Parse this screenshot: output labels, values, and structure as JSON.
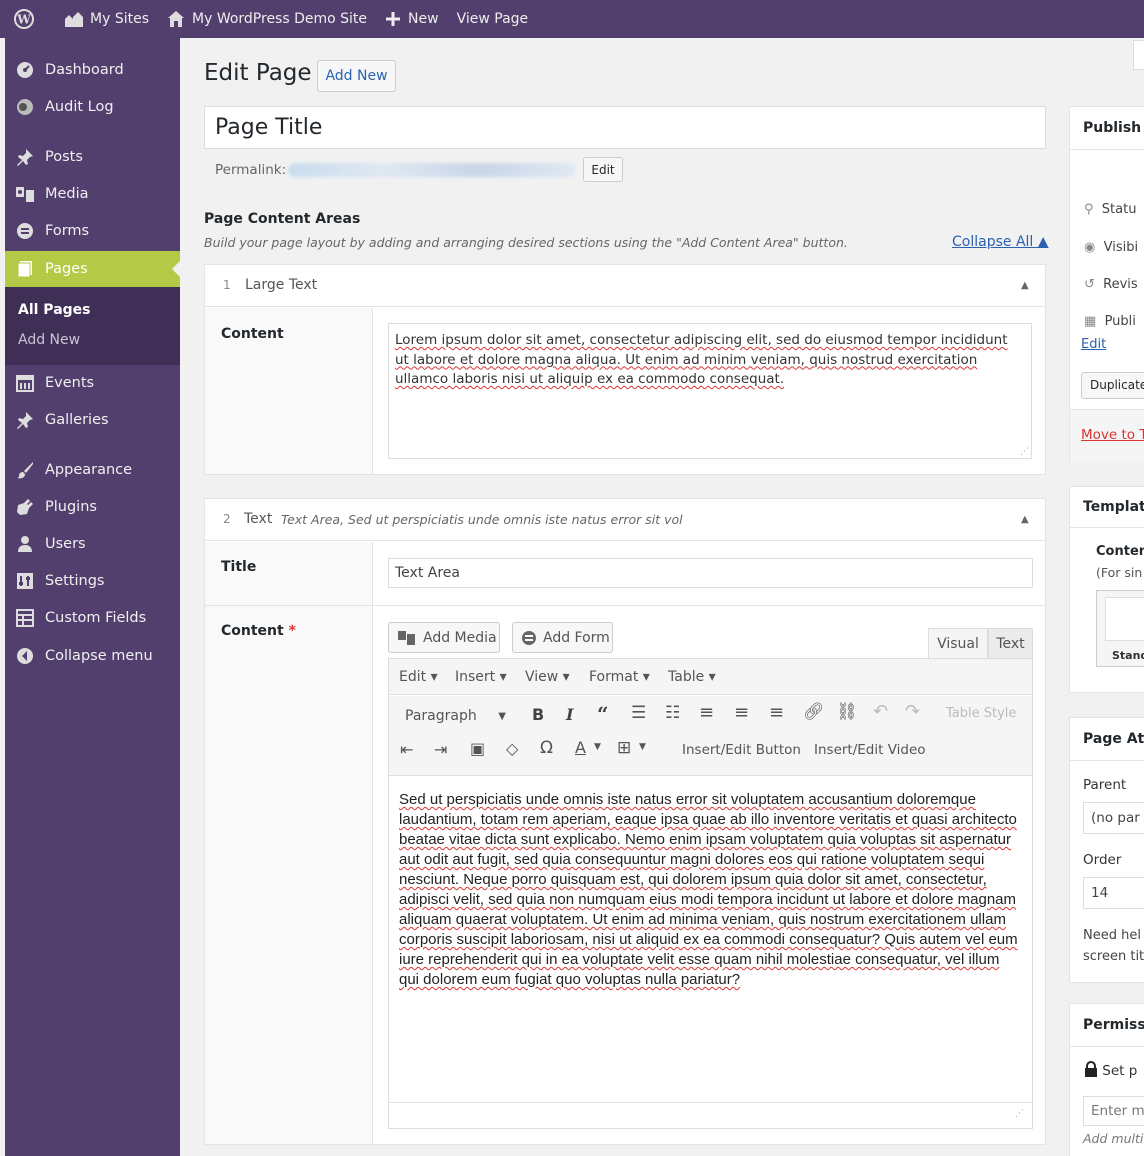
{
  "admin_bar": {
    "items": [
      {
        "label": "My Sites",
        "icon": "my-sites-icon"
      },
      {
        "label": "My WordPress Demo Site",
        "icon": "home-icon"
      },
      {
        "label": "New",
        "icon": "plus-icon"
      },
      {
        "label": "View Page"
      }
    ]
  },
  "sidebar": {
    "items": [
      {
        "label": "Dashboard",
        "icon": "dashboard-icon"
      },
      {
        "label": "Audit Log",
        "icon": "audit-log-icon"
      },
      {
        "label": "Posts",
        "icon": "posts-pin-icon"
      },
      {
        "label": "Media",
        "icon": "media-icon"
      },
      {
        "label": "Forms",
        "icon": "forms-icon"
      },
      {
        "label": "Pages",
        "icon": "pages-icon"
      },
      {
        "label": "Events",
        "icon": "calendar-icon"
      },
      {
        "label": "Galleries",
        "icon": "galleries-pin-icon"
      },
      {
        "label": "Appearance",
        "icon": "appearance-brush-icon"
      },
      {
        "label": "Plugins",
        "icon": "plugins-icon"
      },
      {
        "label": "Users",
        "icon": "users-icon"
      },
      {
        "label": "Settings",
        "icon": "settings-icon"
      },
      {
        "label": "Custom Fields",
        "icon": "custom-fields-icon"
      },
      {
        "label": "Collapse menu",
        "icon": "collapse-icon"
      }
    ],
    "pages_sub": [
      "All Pages",
      "Add New"
    ]
  },
  "header": {
    "title": "Edit Page",
    "add_new": "Add New"
  },
  "post": {
    "title": "Page Title",
    "permalink_label": "Permalink:",
    "permalink_edit": "Edit"
  },
  "content_areas": {
    "heading": "Page Content Areas",
    "description": "Build your page layout by adding and arranging desired sections using the \"Add Content Area\" button.",
    "collapse_all": "Collapse All ▲"
  },
  "area1": {
    "number": "1",
    "type": "Large Text",
    "content_label": "Content",
    "content_text": "Lorem ipsum dolor sit amet, consectetur adipiscing elit, sed do eiusmod tempor incididunt ut labore et dolore magna aliqua. Ut enim ad minim veniam, quis nostrud exercitation ullamco laboris nisi ut aliquip ex ea commodo consequat."
  },
  "area2": {
    "number": "2",
    "type": "Text",
    "subtitle": "Text Area, Sed ut perspiciatis unde omnis iste natus error sit vol",
    "title_label": "Title",
    "title_value": "Text Area",
    "content_label": "Content",
    "required_mark": "*",
    "add_media": "Add Media",
    "add_form": "Add Form",
    "tab_visual": "Visual",
    "tab_text": "Text",
    "menu": [
      "Edit",
      "Insert",
      "View",
      "Format",
      "Table"
    ],
    "format_select": "Paragraph",
    "table_style": "Table Style",
    "insert_edit_button": "Insert/Edit Button",
    "insert_edit_video": "Insert/Edit Video",
    "editor_text": "Sed ut perspiciatis unde omnis iste natus error sit voluptatem accusantium doloremque laudantium, totam rem aperiam, eaque ipsa quae ab illo inventore veritatis et quasi architecto beatae vitae dicta sunt explicabo. Nemo enim ipsam voluptatem quia voluptas sit aspernatur aut odit aut fugit, sed quia consequuntur magni dolores eos qui ratione voluptatem sequi nesciunt. Neque porro quisquam est, qui dolorem ipsum quia dolor sit amet, consectetur, adipisci velit, sed quia non numquam eius modi tempora incidunt ut labore et dolore magnam aliquam quaerat voluptatem. Ut enim ad minima veniam, quis nostrum exercitationem ullam corporis suscipit laboriosam, nisi ut aliquid ex ea commodi consequatur? Quis autem vel eum iure reprehenderit qui in ea voluptate velit esse quam nihil molestiae consequatur, vel illum qui dolorem eum fugiat quo voluptas nulla pariatur?"
  },
  "right_panel": {
    "publish": {
      "title": "Publish",
      "status": "Statu",
      "visibility": "Visibi",
      "revisions": "Revis",
      "published": "Publi",
      "edit": "Edit",
      "duplicate": "Duplicate",
      "move_to_trash": "Move to T"
    },
    "template": {
      "title": "Template",
      "content_label": "Conten",
      "hint": "(For sin",
      "thumb_label": "Stand"
    },
    "page_attributes": {
      "title": "Page Att",
      "parent_label": "Parent",
      "parent_value": "(no par",
      "order_label": "Order",
      "order_value": "14",
      "help_line1": "Need hel",
      "help_line2": "screen tit"
    },
    "permissions": {
      "title": "Permissi",
      "set": "Set p",
      "enter": "Enter m",
      "add_multi": "Add multi"
    }
  }
}
